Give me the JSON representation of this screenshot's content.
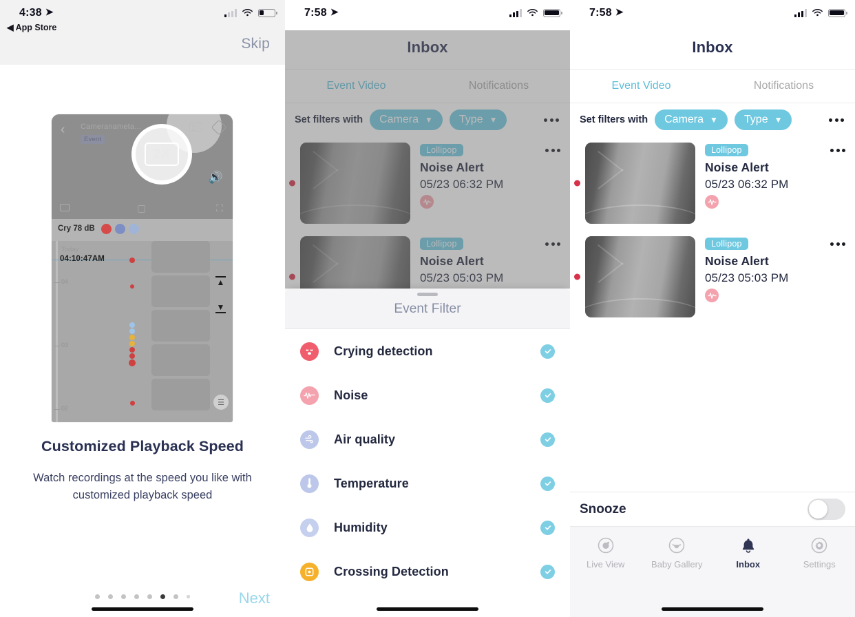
{
  "panel1": {
    "status": {
      "time": "4:38",
      "back_label": "App Store"
    },
    "skip_label": "Skip",
    "mock": {
      "camera_name": "Cameranameta...",
      "event_tag": "Event",
      "speed_badge": "2X",
      "cry_label": "Cry 78 dB",
      "today_label": "Today",
      "timestamp": "04:10:47AM",
      "hour_labels": [
        "04",
        "03",
        "02"
      ]
    },
    "title": "Customized Playback Speed",
    "subtitle": "Watch recordings at the speed you like with customized playback speed",
    "next_label": "Next",
    "dots_total": 8,
    "dots_active_index": 5
  },
  "panel2": {
    "status": {
      "time": "7:58"
    },
    "nav_title": "Inbox",
    "tabs": [
      {
        "label": "Event Video",
        "active": true
      },
      {
        "label": "Notifications",
        "active": false
      }
    ],
    "filterbar": {
      "label": "Set filters with",
      "camera_label": "Camera",
      "type_label": "Type",
      "more_icon": "ellipsis-icon"
    },
    "events": [
      {
        "tag": "Lollipop",
        "title": "Noise Alert",
        "time": "05/23 06:32 PM",
        "icon": "noise-icon"
      },
      {
        "tag": "Lollipop",
        "title": "Noise Alert",
        "time": "05/23 05:03 PM",
        "icon": "noise-icon"
      }
    ],
    "sheet": {
      "title": "Event Filter",
      "items": [
        {
          "label": "Crying detection",
          "icon": "crying-face-icon",
          "color": "#f05d6c",
          "checked": true
        },
        {
          "label": "Noise",
          "icon": "noise-wave-icon",
          "color": "#f4a3ae",
          "checked": true
        },
        {
          "label": "Air quality",
          "icon": "air-quality-icon",
          "color": "#b9c4e8",
          "checked": true
        },
        {
          "label": "Temperature",
          "icon": "thermometer-icon",
          "color": "#b9c4e8",
          "checked": true
        },
        {
          "label": "Humidity",
          "icon": "humidity-drop-icon",
          "color": "#c3cdec",
          "checked": true
        },
        {
          "label": "Crossing Detection",
          "icon": "crossing-detection-icon",
          "color": "#f5b12c",
          "checked": true
        }
      ]
    }
  },
  "panel3": {
    "status": {
      "time": "7:58"
    },
    "nav_title": "Inbox",
    "tabs": [
      {
        "label": "Event Video",
        "active": true
      },
      {
        "label": "Notifications",
        "active": false
      }
    ],
    "filterbar": {
      "label": "Set filters with",
      "camera_label": "Camera",
      "type_label": "Type",
      "more_icon": "ellipsis-icon"
    },
    "events": [
      {
        "tag": "Lollipop",
        "title": "Noise Alert",
        "time": "05/23 06:32 PM",
        "icon": "noise-icon"
      },
      {
        "tag": "Lollipop",
        "title": "Noise Alert",
        "time": "05/23 05:03 PM",
        "icon": "noise-icon"
      }
    ],
    "snooze": {
      "label": "Snooze",
      "enabled": false
    },
    "tabbar": [
      {
        "label": "Live View",
        "icon": "live-view-icon",
        "active": false
      },
      {
        "label": "Baby Gallery",
        "icon": "baby-gallery-icon",
        "active": false
      },
      {
        "label": "Inbox",
        "icon": "bell-icon",
        "active": true
      },
      {
        "label": "Settings",
        "icon": "gear-icon",
        "active": false
      }
    ]
  },
  "colors": {
    "accent_cyan": "#6ec8e0",
    "tab_active": "#5bbdd8",
    "title_navy": "#23283f",
    "unread_red": "#d8314a",
    "next_blue": "#9ad7ea"
  }
}
